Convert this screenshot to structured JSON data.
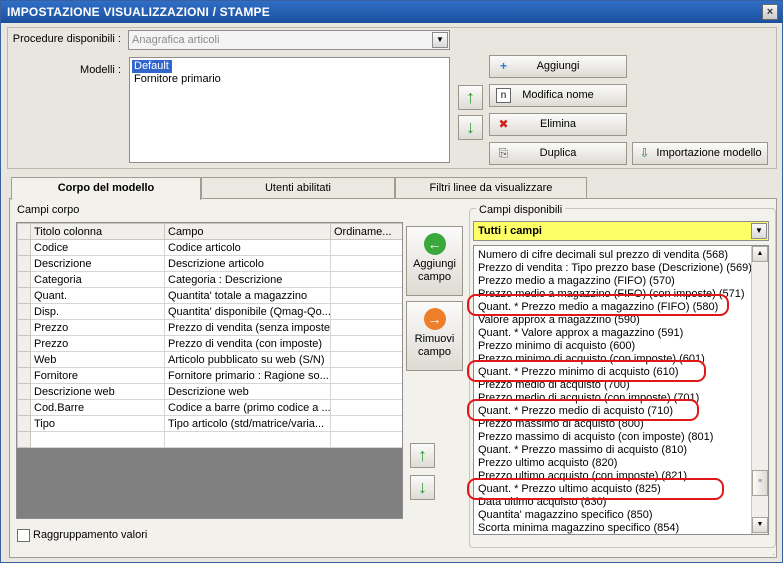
{
  "window": {
    "title": "IMPOSTAZIONE VISUALIZZAZIONI / STAMPE",
    "close": "×"
  },
  "procedure": {
    "label": "Procedure disponibili :",
    "value": "Anagrafica articoli",
    "arrow": "▼"
  },
  "models": {
    "label": "Modelli :",
    "items": [
      "Default",
      "Fornitore primario"
    ]
  },
  "buttons": {
    "aggiungi": "Aggiungi",
    "modifica_nome": "Modifica nome",
    "elimina": "Elimina",
    "duplica": "Duplica",
    "importazione_modello": "Importazione modello",
    "aggiungi_campo": "Aggiungi campo",
    "rimuovi_campo": "Rimuovi campo"
  },
  "icons": {
    "up": "↑",
    "down": "↓",
    "add": "+",
    "n": "n",
    "x": "✖",
    "dup": "⎘",
    "imp": "⇩",
    "left": "←",
    "right": "→"
  },
  "tabs": [
    "Corpo del modello",
    "Utenti abilitati",
    "Filtri linee da visualizzare"
  ],
  "campi_corpo": {
    "legend": "Campi corpo",
    "columns": [
      "Titolo colonna",
      "Campo",
      "Ordiname..."
    ],
    "rows": [
      [
        "Codice",
        "Codice articolo",
        ""
      ],
      [
        "Descrizione",
        "Descrizione articolo",
        ""
      ],
      [
        "Categoria",
        "Categoria : Descrizione",
        ""
      ],
      [
        "Quant.",
        "Quantita' totale a magazzino",
        ""
      ],
      [
        "Disp.",
        "Quantita' disponibile (Qmag-Qo...",
        ""
      ],
      [
        "Prezzo",
        "Prezzo di vendita (senza imposte)",
        ""
      ],
      [
        "Prezzo",
        "Prezzo di vendita (con imposte)",
        ""
      ],
      [
        "Web",
        "Articolo pubblicato su web (S/N)",
        ""
      ],
      [
        "Fornitore",
        "Fornitore primario : Ragione so...",
        ""
      ],
      [
        "Descrizione web",
        "Descrizione web",
        ""
      ],
      [
        "Cod.Barre",
        "Codice a barre (primo codice a ...",
        ""
      ],
      [
        "Tipo",
        "Tipo articolo (std/matrice/varia...",
        ""
      ],
      [
        "",
        "",
        ""
      ]
    ]
  },
  "campi_disponibili": {
    "legend": "Campi disponibili",
    "filter": "Tutti i campi",
    "items": [
      "Numero di cifre decimali sul prezzo di vendita (568)",
      "Prezzo di vendita : Tipo prezzo base (Descrizione) (569)",
      "Prezzo medio a magazzino (FIFO) (570)",
      "Prezzo medio a magazzino (FIFO) (con imposte) (571)",
      "Quant. * Prezzo medio a magazzino (FIFO) (580)",
      "Valore approx a magazzino (590)",
      "Quant. * Valore approx a magazzino (591)",
      "Prezzo minimo di acquisto (600)",
      "Prezzo minimo di acquisto (con imposte) (601)",
      "Quant. * Prezzo minimo di acquisto (610)",
      "Prezzo medio di acquisto (700)",
      "Prezzo medio di acquisto (con imposte) (701)",
      "Quant. * Prezzo medio di acquisto (710)",
      "Prezzo massimo di acquisto (800)",
      "Prezzo massimo di acquisto (con imposte) (801)",
      "Quant. * Prezzo massimo di acquisto (810)",
      "Prezzo ultimo acquisto (820)",
      "Prezzo ultimo acquisto (con imposte) (821)",
      "Quant. * Prezzo ultimo acquisto (825)",
      "Data ultimo acquisto (830)",
      "Quantita' magazzino specifico (850)",
      "Scorta minima magazzino specifico (854)"
    ]
  },
  "grouping": {
    "label": "Raggruppamento valori"
  }
}
